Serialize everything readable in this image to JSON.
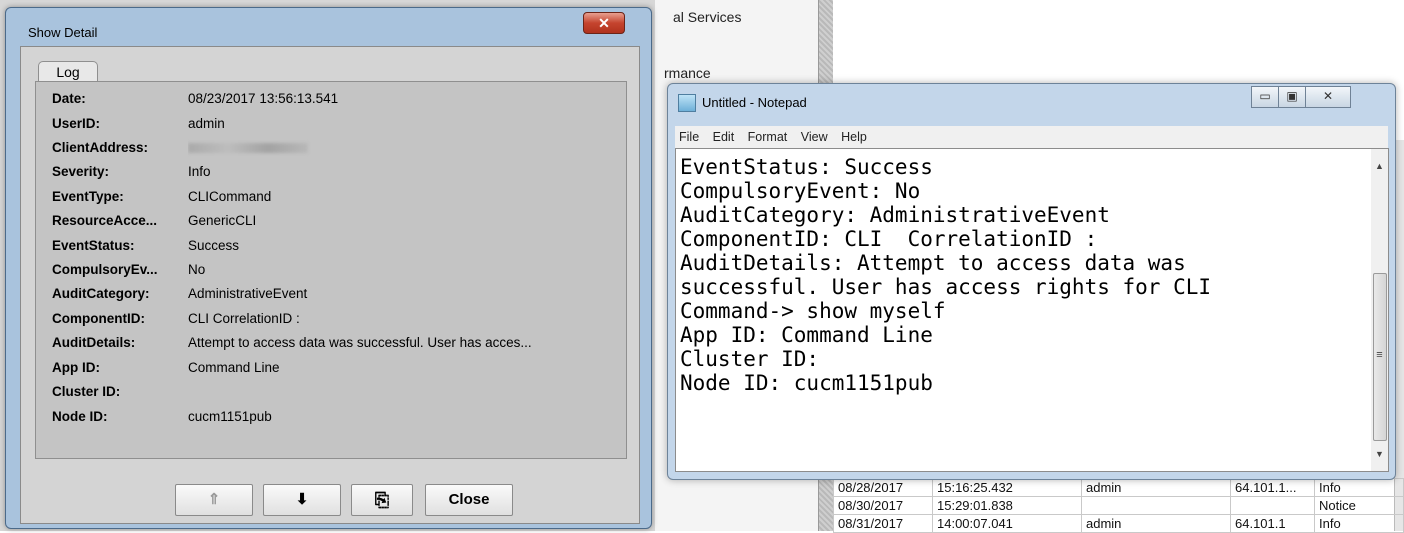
{
  "background": {
    "services_label": "al Services",
    "performance_label": "rmance",
    "rows": [
      [
        "08/28/2017",
        "15:16:25.432",
        "admin",
        "64.101.1...",
        "Info"
      ],
      [
        "08/30/2017",
        "15:29:01.838",
        "",
        "",
        "Notice"
      ],
      [
        "08/31/2017",
        "14:00:07.041",
        "admin",
        "64.101.1",
        "Info"
      ]
    ]
  },
  "show_detail": {
    "title": "Show Detail",
    "close_glyph": "✕",
    "tab_label": "Log",
    "fields": [
      {
        "label": "Date:",
        "value": "08/23/2017  13:56:13.541"
      },
      {
        "label": "UserID:",
        "value": "admin"
      },
      {
        "label": "ClientAddress:",
        "value": ""
      },
      {
        "label": "Severity:",
        "value": "Info"
      },
      {
        "label": "EventType:",
        "value": "CLICommand"
      },
      {
        "label": "ResourceAcce...",
        "value": "GenericCLI"
      },
      {
        "label": "EventStatus:",
        "value": "Success"
      },
      {
        "label": "CompulsoryEv...",
        "value": "No"
      },
      {
        "label": "AuditCategory:",
        "value": "AdministrativeEvent"
      },
      {
        "label": "ComponentID:",
        "value": "CLI  CorrelationID :"
      },
      {
        "label": "AuditDetails:",
        "value": "Attempt to access data was successful. User has acces..."
      },
      {
        "label": "App ID:",
        "value": "Command Line"
      },
      {
        "label": "Cluster ID:",
        "value": ""
      },
      {
        "label": "Node ID:",
        "value": "cucm1151pub"
      }
    ],
    "buttons": {
      "up": "⇑",
      "down": "⬇",
      "copy_icon": "⎘",
      "close": "Close"
    }
  },
  "notepad": {
    "title": "Untitled - Notepad",
    "controls": {
      "minimize": "▭",
      "maximize": "▣",
      "close": "✕"
    },
    "menu": [
      "File",
      "Edit",
      "Format",
      "View",
      "Help"
    ],
    "lines": [
      "EventStatus: Success",
      "CompulsoryEvent: No",
      "AuditCategory: AdministrativeEvent",
      "ComponentID: CLI  CorrelationID :",
      "AuditDetails: Attempt to access data was",
      "successful. User has access rights for CLI",
      "Command-> show myself",
      "App ID: Command Line",
      "Cluster ID:",
      "Node ID: cucm1151pub"
    ],
    "scroll_up": "▲",
    "scroll_down": "▼",
    "grip": "≡"
  }
}
